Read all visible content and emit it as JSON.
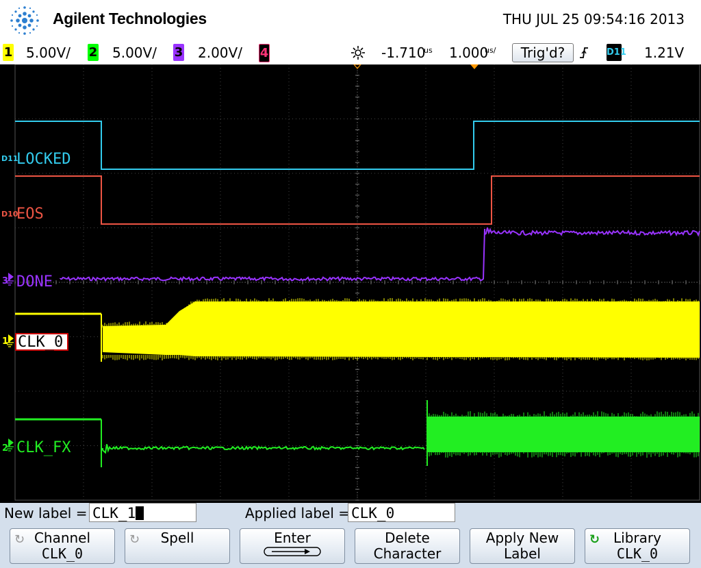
{
  "header": {
    "brand": "Agilent Technologies",
    "datetime": "THU JUL 25 09:54:16 2013"
  },
  "status_bar": {
    "channels": [
      {
        "num": "1",
        "scale": "5.00V/",
        "color": "#ffff00"
      },
      {
        "num": "2",
        "scale": "5.00V/",
        "color": "#00ff00"
      },
      {
        "num": "3",
        "scale": "2.00V/",
        "color": "#9933ff"
      },
      {
        "num": "4",
        "scale": "",
        "color": "#ff3377"
      }
    ],
    "delay": "-1.710",
    "delay_unit": "us",
    "timebase": "1.000",
    "timebase_unit": "us/",
    "trigger_state": "Trig'd?",
    "trigger_slope": "rising-edge-icon",
    "trigger_source": "D11",
    "trigger_level": "1.21V"
  },
  "traces": {
    "locked": {
      "label": "LOCKED",
      "tag": "D11",
      "color": "#33ccee"
    },
    "eos": {
      "label": "EOS",
      "tag": "D10",
      "color": "#ee5544"
    },
    "done": {
      "label": "DONE",
      "tag": "3",
      "color": "#9933ff"
    },
    "clk0": {
      "label": "CLK_0",
      "tag": "1",
      "color": "#ffff00"
    },
    "clkfx": {
      "label": "CLK_FX",
      "tag": "2",
      "color": "#22ee22"
    }
  },
  "label_editor": {
    "new_label_caption": "New label =",
    "new_label_value": "CLK_1",
    "applied_label_caption": "Applied label =",
    "applied_label_value": "CLK_0"
  },
  "softkeys": [
    {
      "line1": "Channel",
      "line2": "CLK_0",
      "icon": "rotate-knob-icon"
    },
    {
      "line1": "Spell",
      "line2": "",
      "icon": "rotate-knob-icon"
    },
    {
      "line1": "Enter",
      "line2": "",
      "icon": "enter-arrow-icon"
    },
    {
      "line1": "Delete",
      "line2": "Character",
      "icon": ""
    },
    {
      "line1": "Apply New",
      "line2": "Label",
      "icon": ""
    },
    {
      "line1": "Library",
      "line2": "CLK_0",
      "icon": "rotate-knob-icon"
    }
  ]
}
